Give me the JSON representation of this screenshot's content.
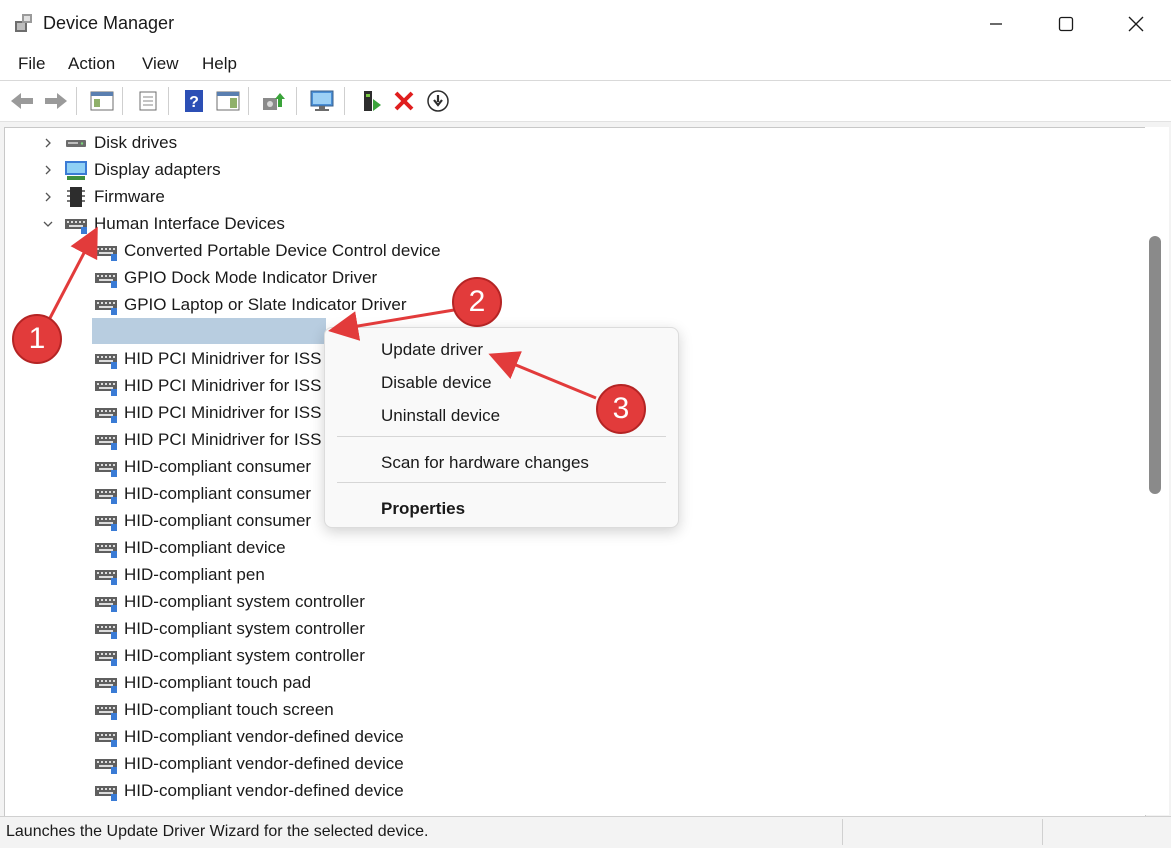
{
  "window": {
    "title": "Device Manager"
  },
  "menu": [
    "File",
    "Action",
    "View",
    "Help"
  ],
  "tree": {
    "categories": [
      {
        "label": "Disk drives",
        "icon": "disk-drive-icon",
        "expanded": false
      },
      {
        "label": "Display adapters",
        "icon": "display-adapter-icon",
        "expanded": false
      },
      {
        "label": "Firmware",
        "icon": "firmware-chip-icon",
        "expanded": false
      },
      {
        "label": "Human Interface Devices",
        "icon": "hid-icon",
        "expanded": true
      }
    ],
    "devices": [
      "Converted Portable Device Control device",
      "GPIO Dock Mode Indicator Driver",
      "GPIO Laptop or Slate Indicator Driver",
      "",
      "HID PCI Minidriver for ISS",
      "HID PCI Minidriver for ISS",
      "HID PCI Minidriver for ISS",
      "HID PCI Minidriver for ISS",
      "HID-compliant consumer",
      "HID-compliant consumer",
      "HID-compliant consumer",
      "HID-compliant device",
      "HID-compliant pen",
      "HID-compliant system controller",
      "HID-compliant system controller",
      "HID-compliant system controller",
      "HID-compliant touch pad",
      "HID-compliant touch screen",
      "HID-compliant vendor-defined device",
      "HID-compliant vendor-defined device",
      "HID-compliant vendor-defined device"
    ]
  },
  "context_menu": {
    "update": "Update driver",
    "disable": "Disable device",
    "uninstall": "Uninstall device",
    "scan": "Scan for hardware changes",
    "properties": "Properties"
  },
  "status": {
    "text": "Launches the Update Driver Wizard for the selected device."
  },
  "annotations": {
    "badge1": "1",
    "badge2": "2",
    "badge3": "3",
    "color": "#e23b3b"
  }
}
